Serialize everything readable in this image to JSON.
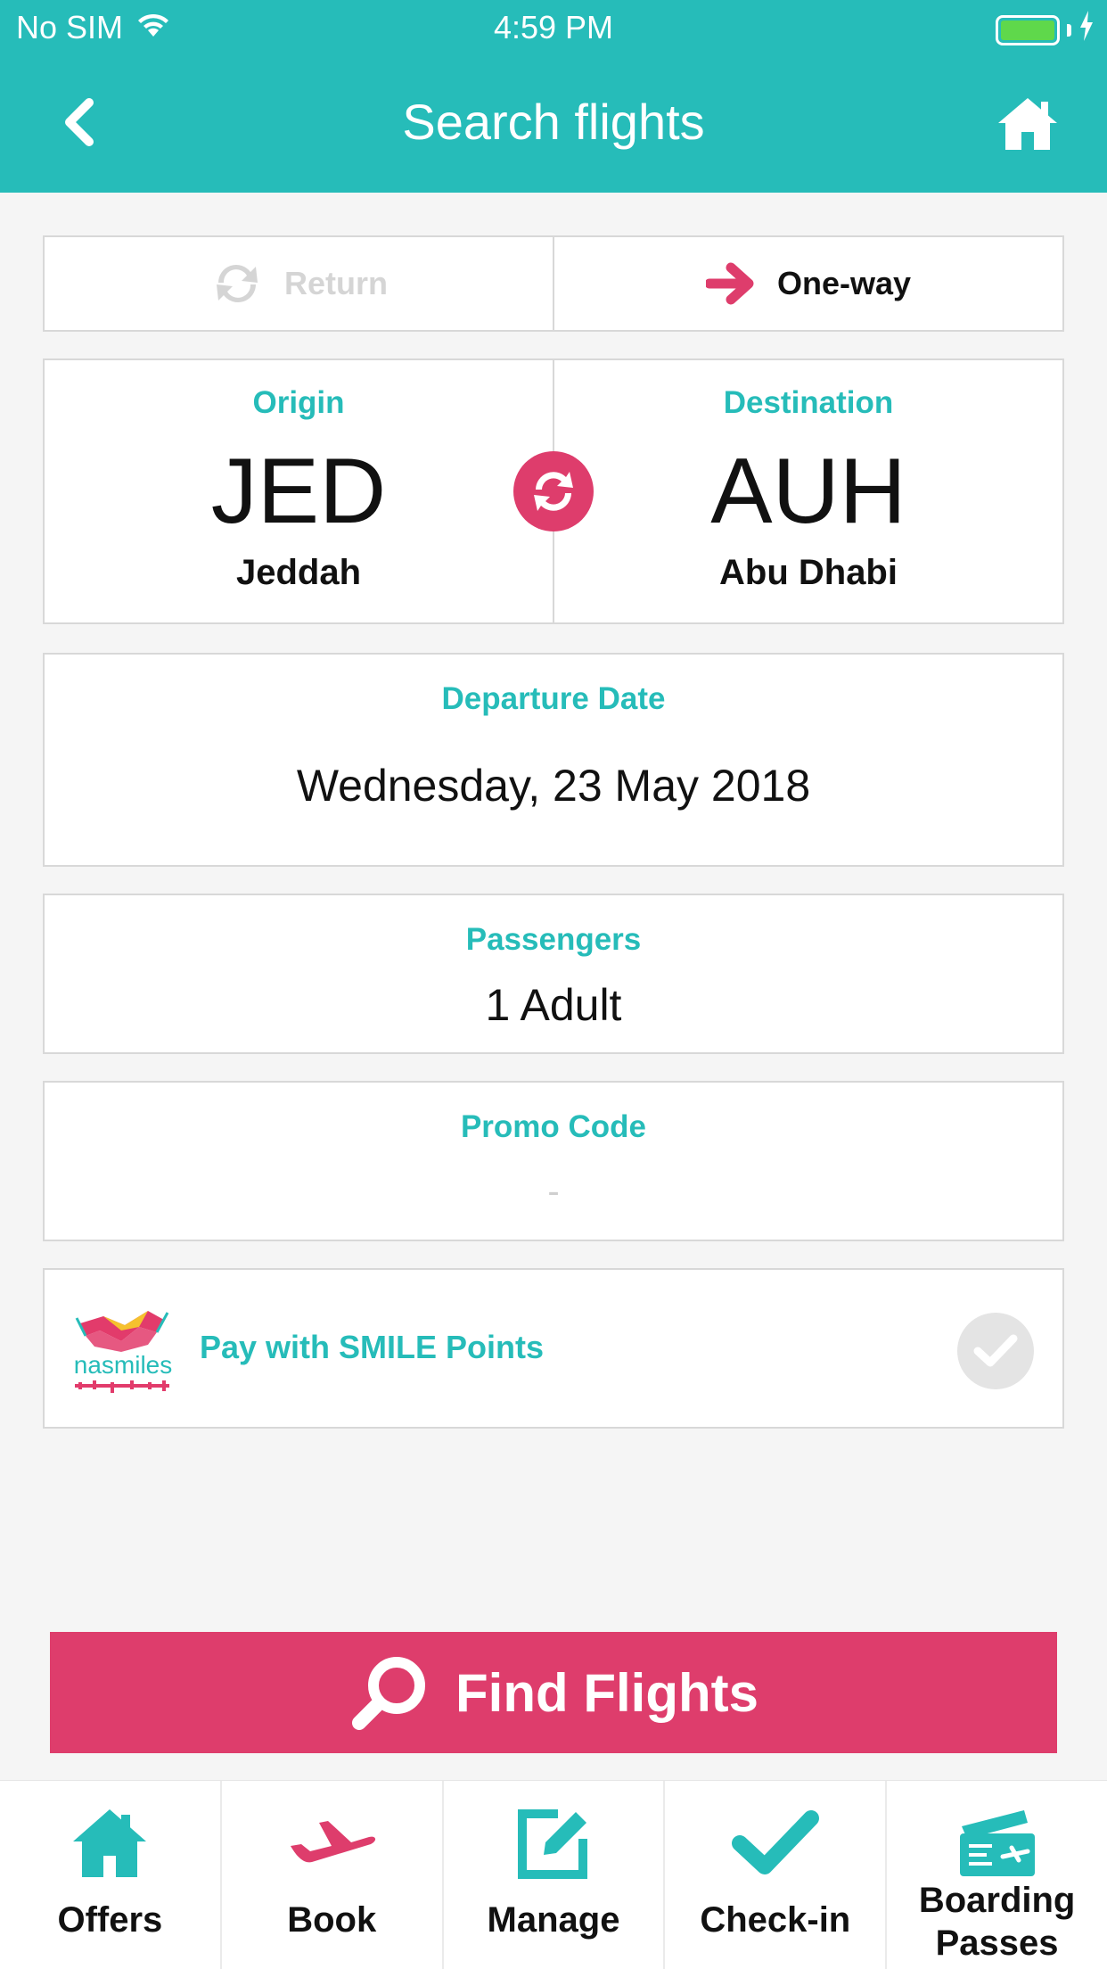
{
  "status": {
    "carrier": "No SIM",
    "time": "4:59 PM"
  },
  "nav": {
    "title": "Search flights"
  },
  "trip_type": {
    "return_label": "Return",
    "oneway_label": "One-way",
    "selected": "One-way"
  },
  "origin": {
    "label": "Origin",
    "code": "JED",
    "city": "Jeddah"
  },
  "destination": {
    "label": "Destination",
    "code": "AUH",
    "city": "Abu Dhabi"
  },
  "departure": {
    "label": "Departure Date",
    "value": "Wednesday, 23 May 2018"
  },
  "passengers": {
    "label": "Passengers",
    "value": "1 Adult"
  },
  "promo": {
    "label": "Promo Code",
    "value": "-"
  },
  "smile": {
    "text": "Pay with SMILE Points",
    "checked": false
  },
  "find": {
    "label": "Find Flights"
  },
  "tabs": [
    {
      "label": "Offers",
      "icon": "house-icon"
    },
    {
      "label": "Book",
      "icon": "plane-icon"
    },
    {
      "label": "Manage",
      "icon": "edit-icon"
    },
    {
      "label": "Check-in",
      "icon": "check-icon"
    },
    {
      "label": "Boarding Passes",
      "icon": "ticket-icon"
    }
  ],
  "colors": {
    "teal": "#26bcb9",
    "pink": "#de3d6c"
  }
}
